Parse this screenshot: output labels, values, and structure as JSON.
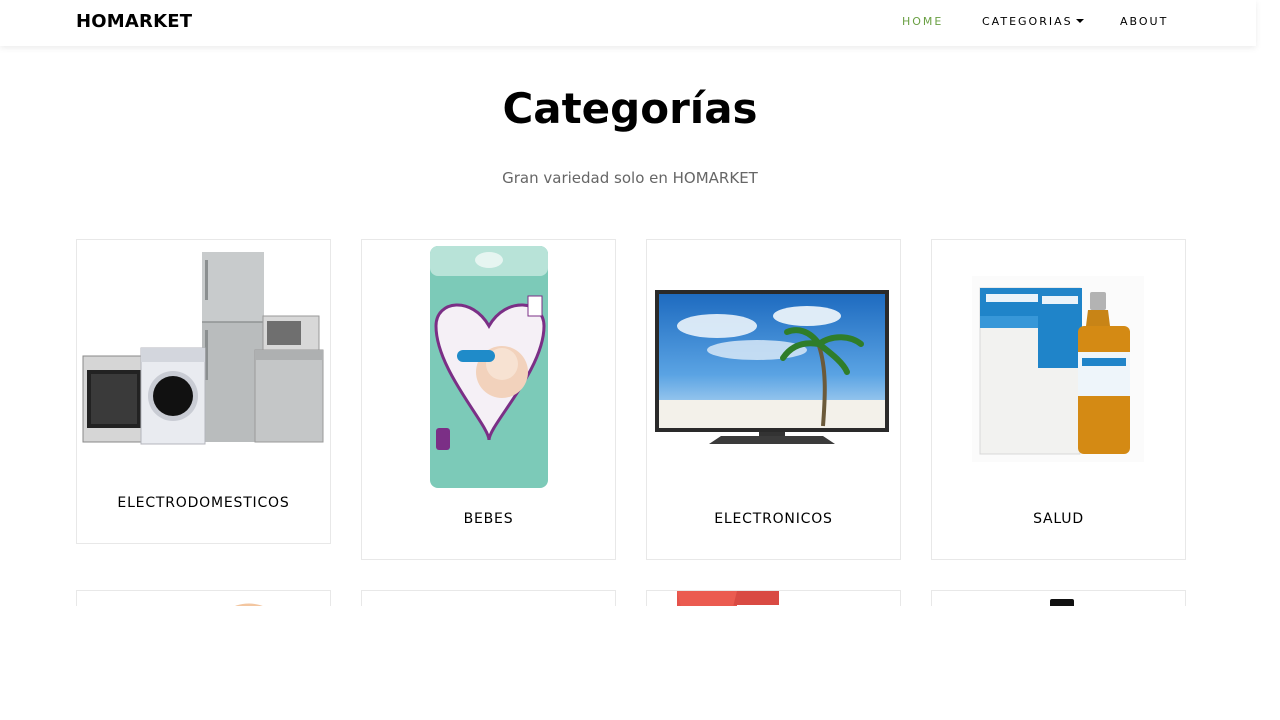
{
  "nav": {
    "brand": "HOMARKET",
    "items": [
      {
        "label": "HOME",
        "active": true
      },
      {
        "label": "CATEGORIAS",
        "dropdown": true
      },
      {
        "label": "ABOUT"
      }
    ],
    "active_color": "#6aa043"
  },
  "header": {
    "title": "Categorías",
    "subtitle": "Gran variedad solo en HOMARKET"
  },
  "categories": [
    {
      "label": "ELECTRODOMESTICOS",
      "image": "appliances-image"
    },
    {
      "label": "BEBES",
      "image": "diapers-image"
    },
    {
      "label": "ELECTRONICOS",
      "image": "television-image"
    },
    {
      "label": "SALUD",
      "image": "medicine-image"
    }
  ]
}
